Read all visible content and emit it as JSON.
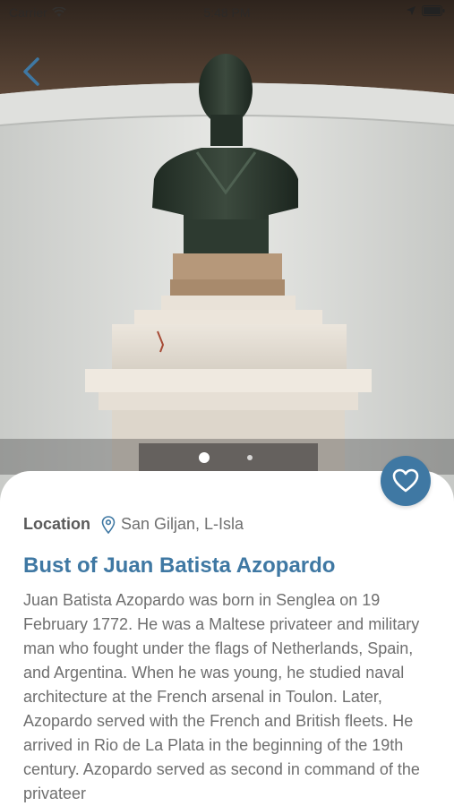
{
  "status": {
    "carrier": "Carrier",
    "time": "5:48 PM"
  },
  "colors": {
    "accent": "#3f78a3",
    "text_muted": "#6f6f6f"
  },
  "icons": {
    "back": "chevron-left-icon",
    "favorite": "heart-icon",
    "location": "map-pin-icon"
  },
  "carousel": {
    "total": 2,
    "active": 1
  },
  "detail": {
    "location_label": "Location",
    "location_value": "San Giljan, L-Isla",
    "title": "Bust of Juan Batista Azopardo",
    "description": "Juan Batista Azopardo was born in Senglea on 19 February 1772. He was a Maltese privateer and military man who fought under the flags of Netherlands, Spain, and Argentina. When he was young, he studied naval architecture at the French arsenal in Toulon. Later, Azopardo served with the French and British fleets. He arrived in Rio de La Plata in the beginning of the 19th century. Azopardo served as second in command of the privateer"
  }
}
